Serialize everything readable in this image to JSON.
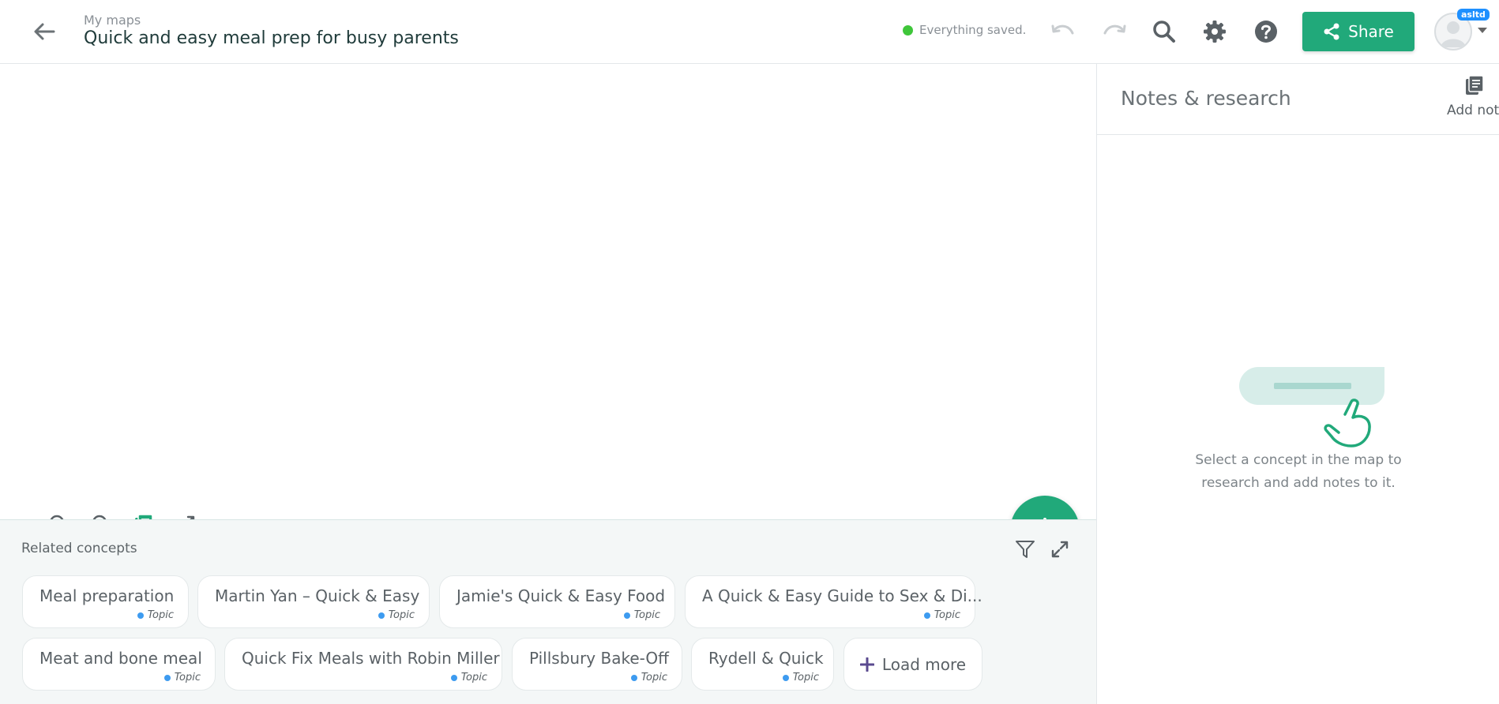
{
  "header": {
    "breadcrumb": "My maps",
    "title": "Quick and easy meal prep for busy parents",
    "save_status": "Everything saved.",
    "share_label": "Share",
    "avatar_badge": "asltd",
    "icons": [
      "back-arrow-icon",
      "undo-icon",
      "redo-icon",
      "search-icon",
      "gear-icon",
      "help-icon",
      "share-icon"
    ]
  },
  "canvas": {
    "tools": [
      "zoom-in-icon",
      "zoom-out-icon",
      "notes-icon",
      "fullscreen-icon"
    ]
  },
  "related": {
    "title": "Related concepts",
    "chips": [
      {
        "label": "Meal preparation",
        "type": "Topic"
      },
      {
        "label": "Martin Yan – Quick & Easy",
        "type": "Topic"
      },
      {
        "label": "Jamie's Quick & Easy Food",
        "type": "Topic"
      },
      {
        "label": "A Quick & Easy Guide to Sex & Di...",
        "type": "Topic"
      },
      {
        "label": "Meat and bone meal",
        "type": "Topic"
      },
      {
        "label": "Quick Fix Meals with Robin Miller",
        "type": "Topic"
      },
      {
        "label": "Pillsbury Bake-Off",
        "type": "Topic"
      },
      {
        "label": "Rydell & Quick",
        "type": "Topic"
      }
    ],
    "load_more_label": "Load more"
  },
  "notes": {
    "title": "Notes & research",
    "add_note_label": "Add note",
    "hint": "Select a concept in the map to research and add notes to it."
  },
  "colors": {
    "accent": "#21a97a",
    "status_dot": "#3fc63a",
    "topic_dot": "#3d9bf0",
    "badge": "#1e90ff"
  }
}
